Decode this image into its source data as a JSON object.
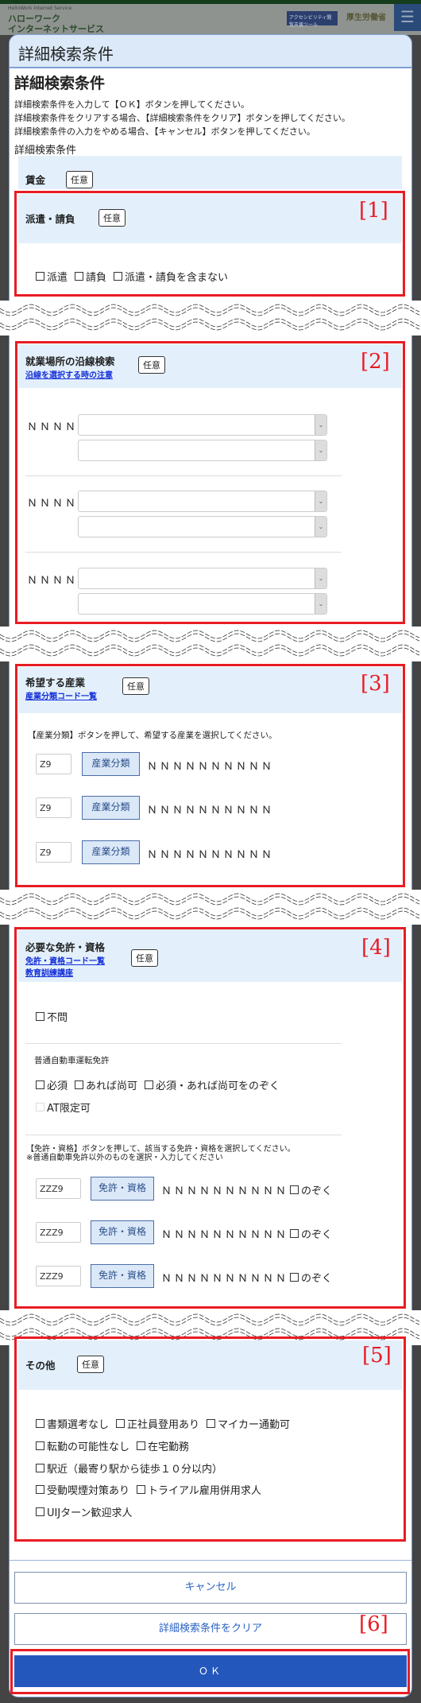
{
  "header": {
    "service_en": "HelloWork Internet Service",
    "service_l1": "ハローワーク",
    "service_l2": "インターネットサービス",
    "accessibility": "アクセシビリティ閲覧支援ツール",
    "ministry": "厚生労働省",
    "menu_icon": "hamburger-icon"
  },
  "modal": {
    "title": "詳細検索条件",
    "heading": "詳細検索条件",
    "instructions": [
      "詳細検索条件を入力して【ＯＫ】ボタンを押してください。",
      "詳細検索条件をクリアする場合、【詳細検索条件をクリア】ボタンを押してください。",
      "詳細検索条件の入力をやめる場合、【キャンセル】ボタンを押してください。"
    ],
    "subheading": "詳細検索条件",
    "optional": "任意"
  },
  "wage": {
    "label": "賃金"
  },
  "dispatch": {
    "label": "派遣・請負",
    "marker": "[1]",
    "options": [
      "派遣",
      "請負",
      "派遣・請負を含まない"
    ]
  },
  "railway": {
    "label": "就業場所の沿線検索",
    "link": "沿線を選択する時の注意",
    "marker": "[2]",
    "rows": [
      {
        "label": "ＮＮＮＮ"
      },
      {
        "label": "ＮＮＮＮ"
      },
      {
        "label": "ＮＮＮＮ"
      }
    ]
  },
  "industry": {
    "label": "希望する産業",
    "link": "産業分類コード一覧",
    "marker": "[3]",
    "instruction": "【産業分類】ボタンを押して、希望する産業を選択してください。",
    "button": "産業分類",
    "rows": [
      {
        "code": "Z9",
        "name": "ＮＮＮＮＮＮＮＮＮＮ"
      },
      {
        "code": "Z9",
        "name": "ＮＮＮＮＮＮＮＮＮＮ"
      },
      {
        "code": "Z9",
        "name": "ＮＮＮＮＮＮＮＮＮＮ"
      }
    ]
  },
  "license": {
    "label": "必要な免許・資格",
    "link1": "免許・資格コード一覧",
    "link2": "教育訓練講座",
    "marker": "[4]",
    "any": "不問",
    "car_label": "普通自動車運転免許",
    "car_options": [
      "必須",
      "あれば尚可",
      "必須・あれば尚可をのぞく"
    ],
    "at": "AT限定可",
    "instruction1": "【免許・資格】ボタンを押して、該当する免許・資格を選択してください。",
    "instruction2": "※普通自動車免許以外のものを選択・入力してください",
    "button": "免許・資格",
    "exclude": "のぞく",
    "rows": [
      {
        "code": "ZZZ9",
        "name": "ＮＮＮＮＮＮＮＮＮＮ"
      },
      {
        "code": "ZZZ9",
        "name": "ＮＮＮＮＮＮＮＮＮＮ"
      },
      {
        "code": "ZZZ9",
        "name": "ＮＮＮＮＮＮＮＮＮＮ"
      }
    ]
  },
  "other": {
    "label": "その他",
    "marker": "[5]",
    "lines": [
      [
        "書類選考なし",
        "正社員登用あり",
        "マイカー通勤可"
      ],
      [
        "転勤の可能性なし",
        "在宅勤務"
      ],
      [
        "駅近（最寄り駅から徒歩１０分以内）"
      ],
      [
        "受動喫煙対策あり",
        "トライアル雇用併用求人"
      ],
      [
        "UIJターン歓迎求人"
      ]
    ]
  },
  "footer": {
    "cancel": "キャンセル",
    "clear": "詳細検索条件をクリア",
    "ok": "ＯＫ",
    "marker": "[6]",
    "ok_color": "#2457bc"
  },
  "colors": {
    "annotation": "#e81c24",
    "section_bg": "#e3f0fc"
  }
}
